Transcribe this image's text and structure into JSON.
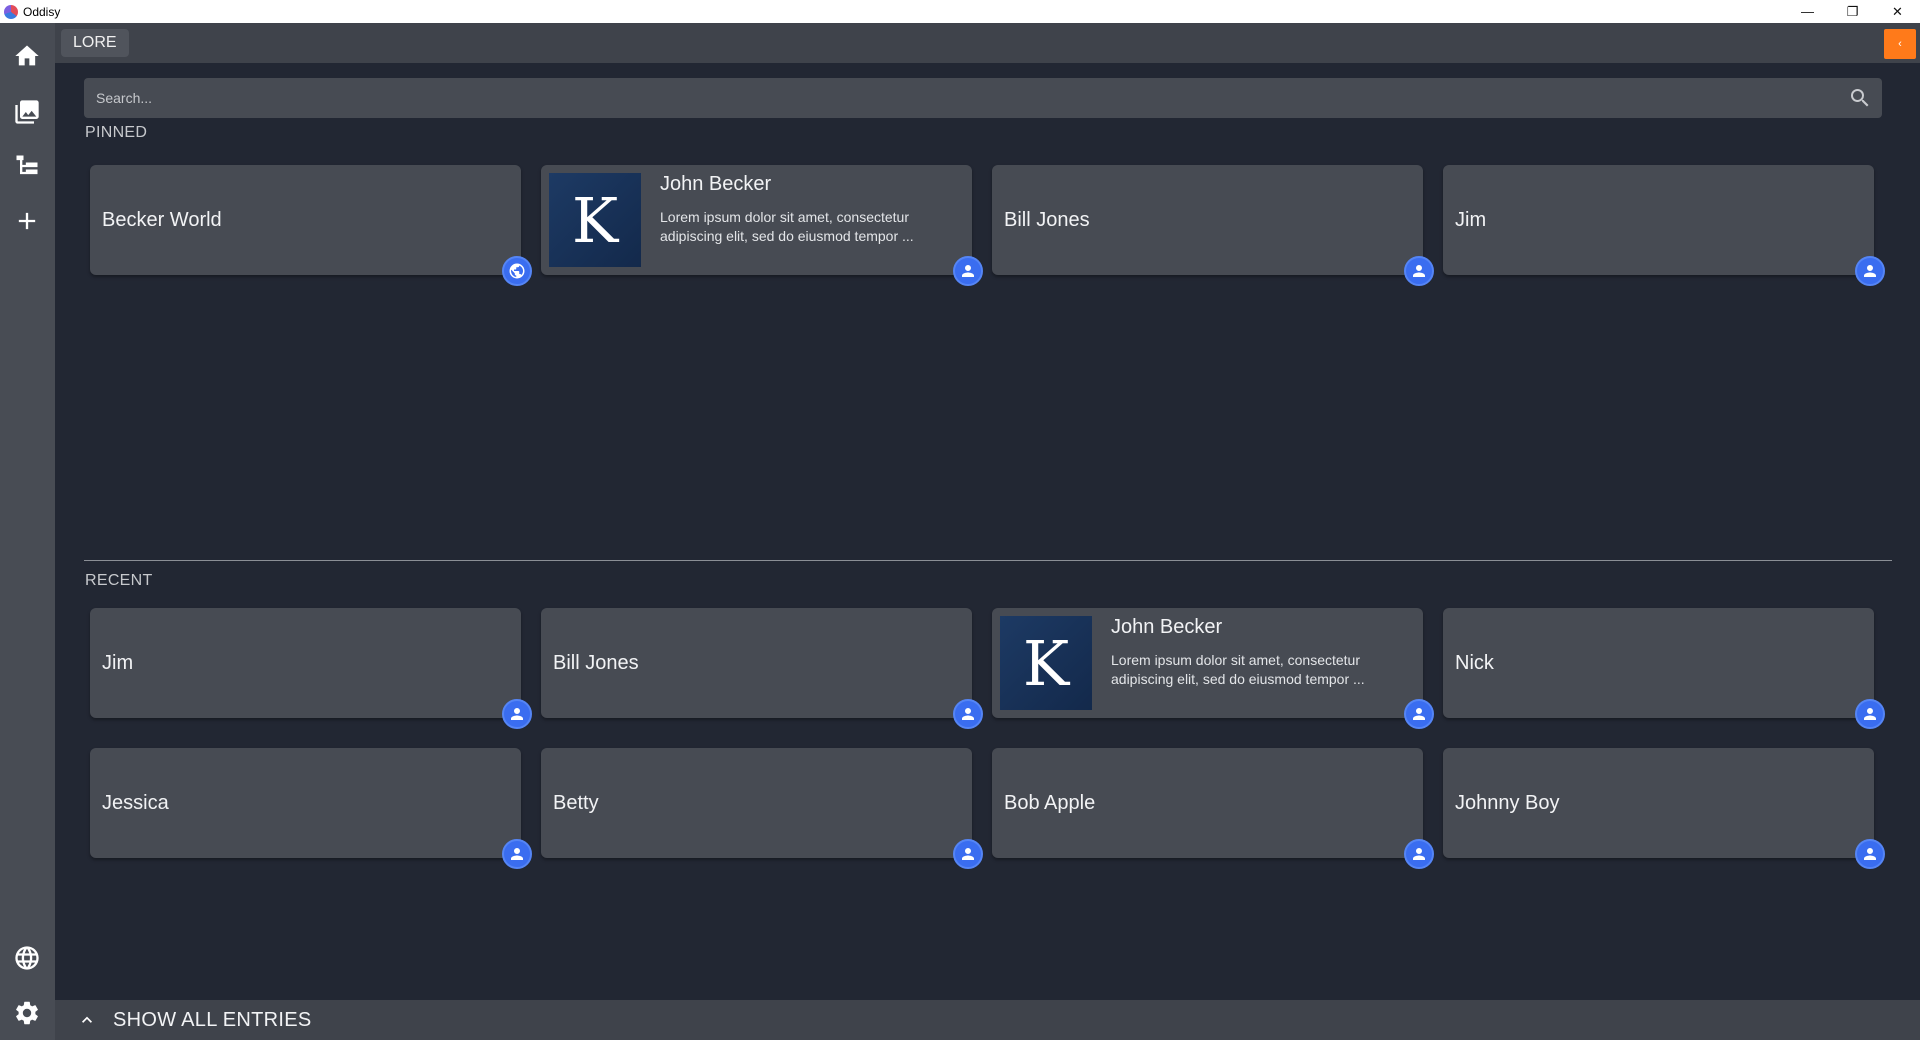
{
  "window": {
    "title": "Oddisy",
    "controls": {
      "minimize": "—",
      "restore": "❐",
      "close": "✕"
    }
  },
  "sidebar": {
    "items": [
      {
        "name": "home",
        "icon": "home-icon"
      },
      {
        "name": "gallery",
        "icon": "images-icon"
      },
      {
        "name": "tree",
        "icon": "tree-icon"
      },
      {
        "name": "add",
        "icon": "plus-icon"
      },
      {
        "name": "world",
        "icon": "globe-icon"
      },
      {
        "name": "settings",
        "icon": "gear-icon"
      }
    ]
  },
  "header": {
    "tab_label": "LORE",
    "collapse_glyph": "‹"
  },
  "search": {
    "placeholder": "Search..."
  },
  "pinned": {
    "label": "PINNED",
    "cards": [
      {
        "title": "Becker World",
        "badge": "globe"
      },
      {
        "title": "John Becker",
        "description": "Lorem ipsum dolor sit amet, consectetur adipiscing elit, sed do eiusmod tempor ...",
        "thumb_letter": "K",
        "badge": "person"
      },
      {
        "title": "Bill Jones",
        "badge": "person"
      },
      {
        "title": "Jim",
        "badge": "person"
      }
    ]
  },
  "recent": {
    "label": "RECENT",
    "cards": [
      {
        "title": "Jim",
        "badge": "person"
      },
      {
        "title": "Bill Jones",
        "badge": "person"
      },
      {
        "title": "John Becker",
        "description": "Lorem ipsum dolor sit amet, consectetur adipiscing elit, sed do eiusmod tempor ...",
        "thumb_letter": "K",
        "badge": "person"
      },
      {
        "title": "Nick",
        "badge": "person"
      },
      {
        "title": "Jessica",
        "badge": "person"
      },
      {
        "title": "Betty",
        "badge": "person"
      },
      {
        "title": "Bob Apple",
        "badge": "person"
      },
      {
        "title": "Johnny Boy",
        "badge": "person"
      }
    ]
  },
  "footer": {
    "show_all_label": "SHOW ALL ENTRIES"
  },
  "colors": {
    "accent_orange": "#ff7a1a",
    "badge_blue": "#3a6df0",
    "card_bg": "#474b53",
    "page_bg": "#222733"
  }
}
